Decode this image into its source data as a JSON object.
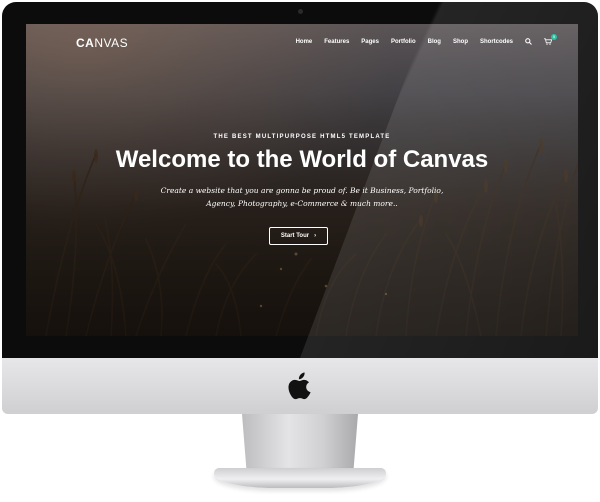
{
  "site": {
    "logo_bold": "CA",
    "logo_rest": "NVAS"
  },
  "nav": {
    "items": [
      {
        "label": "Home"
      },
      {
        "label": "Features"
      },
      {
        "label": "Pages"
      },
      {
        "label": "Portfolio"
      },
      {
        "label": "Blog"
      },
      {
        "label": "Shop"
      },
      {
        "label": "Shortcodes"
      }
    ],
    "search_icon": "search-icon",
    "cart_icon": "cart-icon",
    "cart_count": "5"
  },
  "hero": {
    "subtitle": "THE BEST MULTIPURPOSE HTML5 TEMPLATE",
    "title": "Welcome to the World of Canvas",
    "text": "Create a website that you are gonna be proud of. Be it Business, Portfolio, Agency, Photography, e-Commerce & much more..",
    "button_label": "Start Tour",
    "button_icon": "chevron-right-icon"
  },
  "device": {
    "logo_icon": "apple-logo-icon"
  },
  "colors": {
    "accent": "#1abc9c",
    "bezel": "#0c0c0c",
    "text": "#ffffff"
  }
}
